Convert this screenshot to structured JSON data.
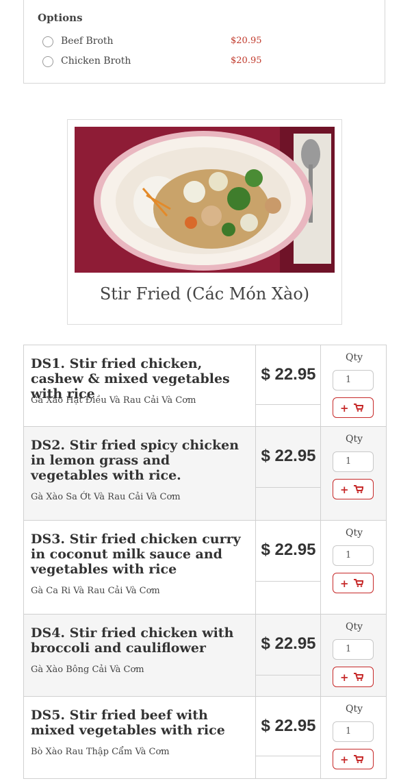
{
  "options": {
    "title": "Options",
    "items": [
      {
        "label": "Beef Broth",
        "price": "$20.95"
      },
      {
        "label": "Chicken Broth",
        "price": "$20.95"
      }
    ]
  },
  "category": {
    "title": "Stir Fried (Các Món Xào)",
    "image_icon": "stir-fry-plate-photo"
  },
  "menu": {
    "qty_label": "Qty",
    "items": [
      {
        "name": "DS1. Stir fried chicken, cashew & mixed vegetables with rice",
        "sub": "Gà Xào Hạt Điều Và Rau Cải Và Cơm",
        "price": "$ 22.95",
        "qty": "1"
      },
      {
        "name": "DS2. Stir fried spicy chicken in lemon grass and vegetables with rice.",
        "sub": "Gà Xào Sa Ớt Và Rau Cải Và Cơm",
        "price": "$ 22.95",
        "qty": "1"
      },
      {
        "name": "DS3. Stir fried chicken curry in coconut milk sauce and vegetables with rice",
        "sub": "Gà Ca Ri Và Rau Cải Và Cơm",
        "price": "$ 22.95",
        "qty": "1"
      },
      {
        "name": "DS4. Stir fried chicken with broccoli and cauliflower",
        "sub": "Gà Xào Bông Cải Và Cơm",
        "price": "$ 22.95",
        "qty": "1"
      },
      {
        "name": "DS5. Stir fried beef with mixed vegetables with rice",
        "sub": "Bò Xào Rau Thập Cẩm Và Cơm",
        "price": "$ 22.95",
        "qty": "1"
      }
    ]
  },
  "colors": {
    "accent": "#c62828",
    "price": "#c0392b"
  }
}
